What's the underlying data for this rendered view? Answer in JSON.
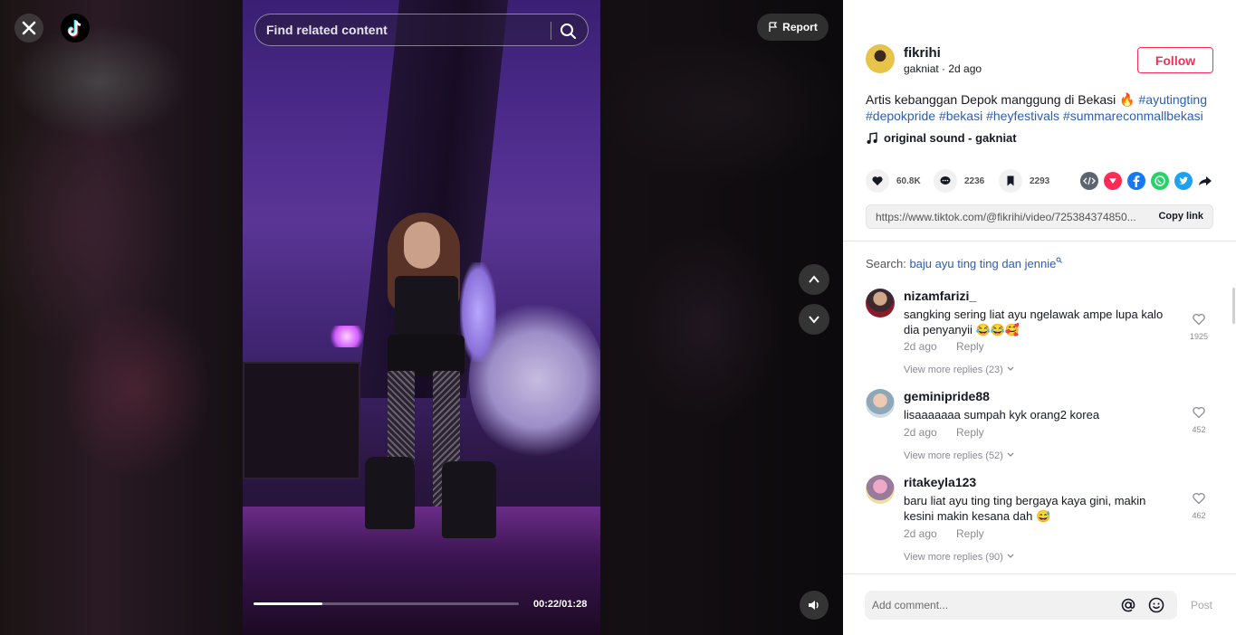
{
  "video": {
    "search_placeholder": "Find related content",
    "report_label": "Report",
    "time": "00:22/01:28",
    "progress_fraction": 0.26
  },
  "icons": {
    "close": "close-icon",
    "logo": "tiktok-logo-icon",
    "search": "search-icon",
    "report": "flag-icon",
    "up": "chevron-up-icon",
    "down": "chevron-down-icon",
    "volume": "volume-icon"
  },
  "post": {
    "author": "fikrihi",
    "subline": "gakniat · 2d ago",
    "follow_label": "Follow",
    "caption_text": "Artis kebanggan Depok manggung di Bekasi 🔥",
    "hashtags": [
      "#ayutingting",
      "#depokpride",
      "#bekasi",
      "#heyfestivals",
      "#summareconmallbekasi"
    ],
    "music": "original sound - gakniat",
    "likes": "60.8K",
    "comments": "2236",
    "saves": "2293",
    "link": "https://www.tiktok.com/@fikrihi/video/725384374850...",
    "copy_label": "Copy link"
  },
  "colors": {
    "accent": "#fe2c55",
    "link": "#2b5db9",
    "embed": "#5c6470",
    "pinterest": "#fe2c55",
    "facebook": "#1877f2",
    "whatsapp": "#25d366",
    "twitter": "#1da1f2"
  },
  "search_suggestion": {
    "label": "Search:",
    "query": "baju ayu ting ting dan jennie"
  },
  "comments": [
    {
      "user": "nizamfarizi_",
      "text": "sangking sering liat ayu ngelawak ampe lupa kalo dia penyanyii 😂😂🥰",
      "time": "2d ago",
      "reply": "Reply",
      "likes": "1925",
      "more": "View more replies (23)"
    },
    {
      "user": "geminipride88",
      "text": "lisaaaaaaa sumpah kyk orang2 korea",
      "time": "2d ago",
      "reply": "Reply",
      "likes": "452",
      "more": "View more replies (52)"
    },
    {
      "user": "ritakeyla123",
      "text": "baru liat ayu ting ting bergaya kaya gini, makin kesini makin kesana dah 😅",
      "time": "2d ago",
      "reply": "Reply",
      "likes": "462",
      "more": "View more replies (90)"
    }
  ],
  "composer": {
    "placeholder": "Add comment...",
    "post_label": "Post"
  }
}
